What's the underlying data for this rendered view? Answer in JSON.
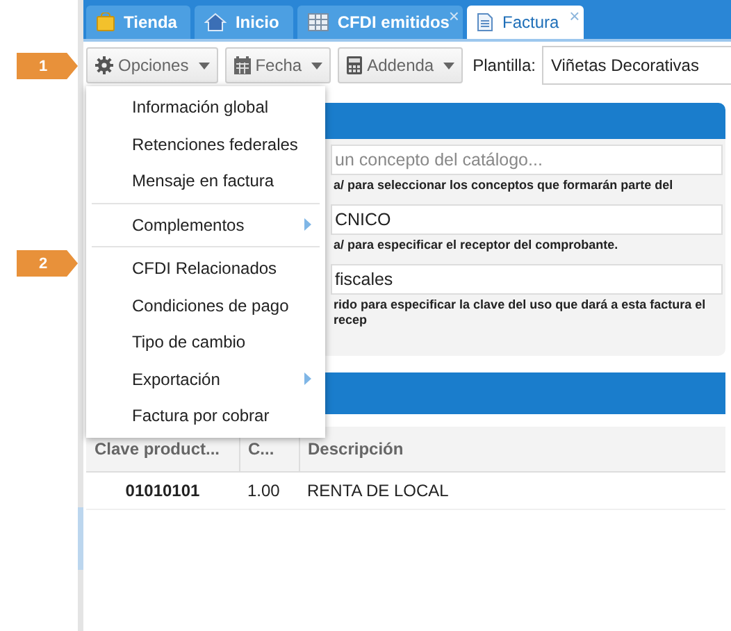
{
  "callouts": [
    "1",
    "2"
  ],
  "tabs": [
    {
      "label": "Tienda",
      "selected": false
    },
    {
      "label": "Inicio",
      "selected": false
    },
    {
      "label": "CFDI emitidos",
      "selected": false,
      "close": "×"
    },
    {
      "label": "Factura",
      "selected": true,
      "close": "×"
    }
  ],
  "toolbar": {
    "buttons": [
      "Opciones",
      "Fecha",
      "Addenda"
    ],
    "template_label": "Plantilla:",
    "template_value": "Viñetas Decorativas"
  },
  "form": {
    "fields": [
      {
        "placeholder": "un concepto del catálogo...",
        "help": "a/ para seleccionar los conceptos que formarán parte del"
      },
      {
        "value": "CNICO",
        "help": "a/ para especificar el receptor del comprobante."
      },
      {
        "value": "fiscales",
        "help": "rido para especificar la clave del uso que dará a esta factura el recep"
      }
    ]
  },
  "menu": [
    {
      "kind": "item",
      "label": "Información global"
    },
    {
      "kind": "item",
      "label": "Retenciones federales"
    },
    {
      "kind": "item",
      "label": "Mensaje en factura"
    },
    {
      "kind": "separator"
    },
    {
      "kind": "submenu",
      "label": "Complementos"
    },
    {
      "kind": "separator"
    },
    {
      "kind": "item",
      "label": "CFDI Relacionados"
    },
    {
      "kind": "item",
      "label": "Condiciones de pago"
    },
    {
      "kind": "item",
      "label": "Tipo de cambio"
    },
    {
      "kind": "submenu",
      "label": "Exportación"
    },
    {
      "kind": "item",
      "label": "Factura por cobrar"
    }
  ],
  "table": {
    "columns": [
      "Clave product...",
      "C...",
      "Descripción"
    ],
    "rows": [
      [
        "01010101",
        "1.00",
        "RENTA DE LOCAL"
      ]
    ]
  }
}
